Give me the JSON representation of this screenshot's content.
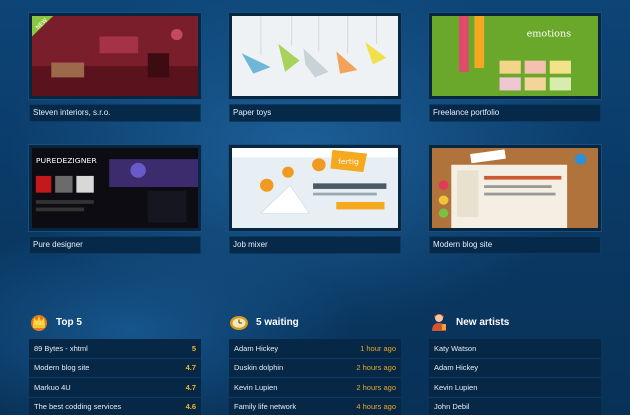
{
  "showcase": [
    {
      "caption": "Steven interiors, s.r.o.",
      "badge": "NEW"
    },
    {
      "caption": "Paper toys"
    },
    {
      "caption": "Freelance portfolio",
      "thumb_text": "emotions"
    },
    {
      "caption": "Pure designer",
      "thumb_text": "PUREDEZIGNER"
    },
    {
      "caption": "Job mixer",
      "thumb_text": "fertig"
    },
    {
      "caption": "Modern blog site"
    }
  ],
  "top5": {
    "title": "Top 5",
    "items": [
      {
        "name": "89 Bytes - xhtml",
        "score": "5"
      },
      {
        "name": "Modern blog site",
        "score": "4.7"
      },
      {
        "name": "Markuo 4U",
        "score": "4.7"
      },
      {
        "name": "The best codding services",
        "score": "4.6"
      }
    ]
  },
  "waiting": {
    "title": "5 waiting",
    "items": [
      {
        "name": "Adam Hickey",
        "time": "1 hour ago"
      },
      {
        "name": "Duskin dolphin",
        "time": "2 hours ago"
      },
      {
        "name": "Kevin Lupien",
        "time": "2 hours ago"
      },
      {
        "name": "Family life network",
        "time": "4 hours ago"
      }
    ]
  },
  "artists": {
    "title": "New artists",
    "items": [
      {
        "name": "Katy Watson"
      },
      {
        "name": "Adam Hickey"
      },
      {
        "name": "Kevin Lupien"
      },
      {
        "name": "John Debil"
      }
    ]
  },
  "colors": {
    "background": "#0a3a66",
    "row_bg": "#062746",
    "accent_orange": "#f0b431"
  }
}
